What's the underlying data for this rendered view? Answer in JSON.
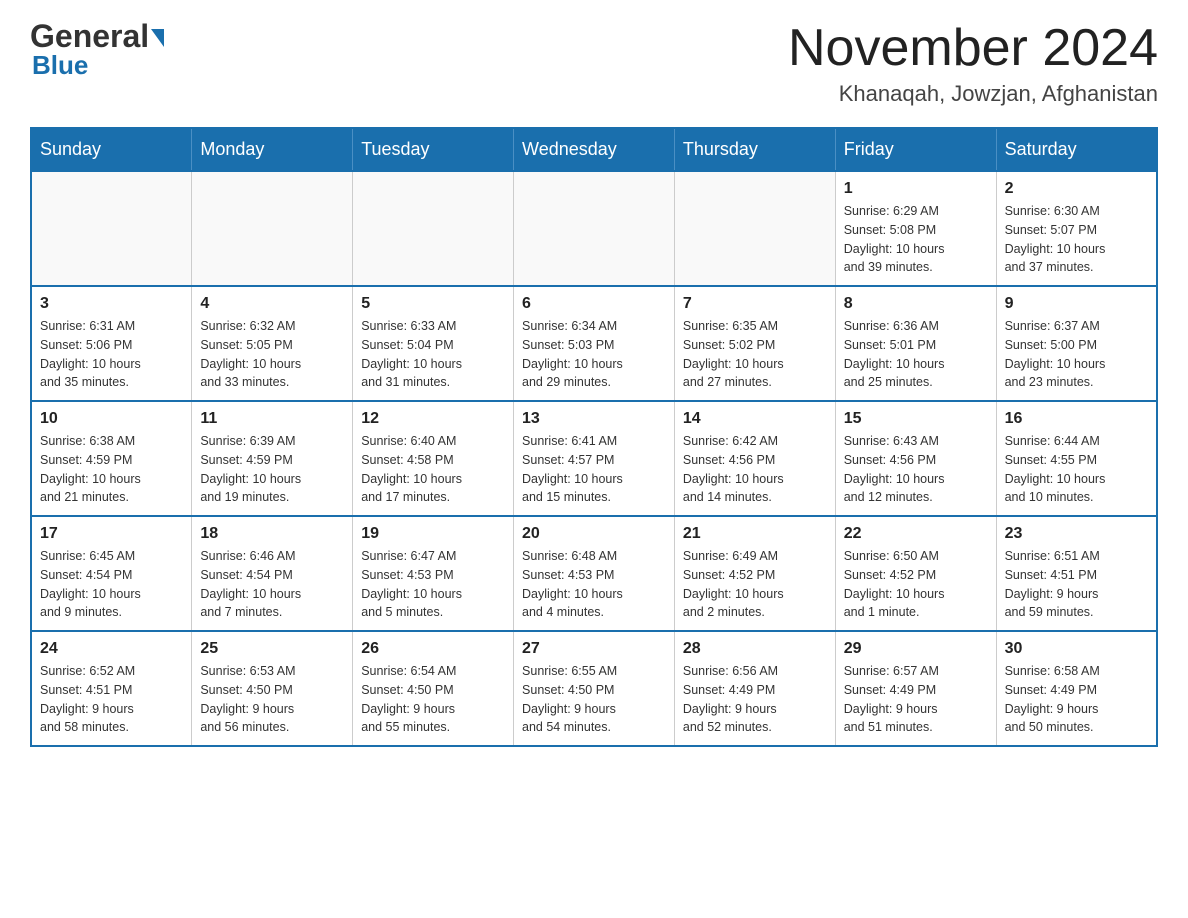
{
  "header": {
    "logo_general": "General",
    "logo_blue": "Blue",
    "month_title": "November 2024",
    "location": "Khanaqah, Jowzjan, Afghanistan"
  },
  "days_of_week": [
    "Sunday",
    "Monday",
    "Tuesday",
    "Wednesday",
    "Thursday",
    "Friday",
    "Saturday"
  ],
  "weeks": [
    [
      {
        "day": "",
        "info": ""
      },
      {
        "day": "",
        "info": ""
      },
      {
        "day": "",
        "info": ""
      },
      {
        "day": "",
        "info": ""
      },
      {
        "day": "",
        "info": ""
      },
      {
        "day": "1",
        "info": "Sunrise: 6:29 AM\nSunset: 5:08 PM\nDaylight: 10 hours\nand 39 minutes."
      },
      {
        "day": "2",
        "info": "Sunrise: 6:30 AM\nSunset: 5:07 PM\nDaylight: 10 hours\nand 37 minutes."
      }
    ],
    [
      {
        "day": "3",
        "info": "Sunrise: 6:31 AM\nSunset: 5:06 PM\nDaylight: 10 hours\nand 35 minutes."
      },
      {
        "day": "4",
        "info": "Sunrise: 6:32 AM\nSunset: 5:05 PM\nDaylight: 10 hours\nand 33 minutes."
      },
      {
        "day": "5",
        "info": "Sunrise: 6:33 AM\nSunset: 5:04 PM\nDaylight: 10 hours\nand 31 minutes."
      },
      {
        "day": "6",
        "info": "Sunrise: 6:34 AM\nSunset: 5:03 PM\nDaylight: 10 hours\nand 29 minutes."
      },
      {
        "day": "7",
        "info": "Sunrise: 6:35 AM\nSunset: 5:02 PM\nDaylight: 10 hours\nand 27 minutes."
      },
      {
        "day": "8",
        "info": "Sunrise: 6:36 AM\nSunset: 5:01 PM\nDaylight: 10 hours\nand 25 minutes."
      },
      {
        "day": "9",
        "info": "Sunrise: 6:37 AM\nSunset: 5:00 PM\nDaylight: 10 hours\nand 23 minutes."
      }
    ],
    [
      {
        "day": "10",
        "info": "Sunrise: 6:38 AM\nSunset: 4:59 PM\nDaylight: 10 hours\nand 21 minutes."
      },
      {
        "day": "11",
        "info": "Sunrise: 6:39 AM\nSunset: 4:59 PM\nDaylight: 10 hours\nand 19 minutes."
      },
      {
        "day": "12",
        "info": "Sunrise: 6:40 AM\nSunset: 4:58 PM\nDaylight: 10 hours\nand 17 minutes."
      },
      {
        "day": "13",
        "info": "Sunrise: 6:41 AM\nSunset: 4:57 PM\nDaylight: 10 hours\nand 15 minutes."
      },
      {
        "day": "14",
        "info": "Sunrise: 6:42 AM\nSunset: 4:56 PM\nDaylight: 10 hours\nand 14 minutes."
      },
      {
        "day": "15",
        "info": "Sunrise: 6:43 AM\nSunset: 4:56 PM\nDaylight: 10 hours\nand 12 minutes."
      },
      {
        "day": "16",
        "info": "Sunrise: 6:44 AM\nSunset: 4:55 PM\nDaylight: 10 hours\nand 10 minutes."
      }
    ],
    [
      {
        "day": "17",
        "info": "Sunrise: 6:45 AM\nSunset: 4:54 PM\nDaylight: 10 hours\nand 9 minutes."
      },
      {
        "day": "18",
        "info": "Sunrise: 6:46 AM\nSunset: 4:54 PM\nDaylight: 10 hours\nand 7 minutes."
      },
      {
        "day": "19",
        "info": "Sunrise: 6:47 AM\nSunset: 4:53 PM\nDaylight: 10 hours\nand 5 minutes."
      },
      {
        "day": "20",
        "info": "Sunrise: 6:48 AM\nSunset: 4:53 PM\nDaylight: 10 hours\nand 4 minutes."
      },
      {
        "day": "21",
        "info": "Sunrise: 6:49 AM\nSunset: 4:52 PM\nDaylight: 10 hours\nand 2 minutes."
      },
      {
        "day": "22",
        "info": "Sunrise: 6:50 AM\nSunset: 4:52 PM\nDaylight: 10 hours\nand 1 minute."
      },
      {
        "day": "23",
        "info": "Sunrise: 6:51 AM\nSunset: 4:51 PM\nDaylight: 9 hours\nand 59 minutes."
      }
    ],
    [
      {
        "day": "24",
        "info": "Sunrise: 6:52 AM\nSunset: 4:51 PM\nDaylight: 9 hours\nand 58 minutes."
      },
      {
        "day": "25",
        "info": "Sunrise: 6:53 AM\nSunset: 4:50 PM\nDaylight: 9 hours\nand 56 minutes."
      },
      {
        "day": "26",
        "info": "Sunrise: 6:54 AM\nSunset: 4:50 PM\nDaylight: 9 hours\nand 55 minutes."
      },
      {
        "day": "27",
        "info": "Sunrise: 6:55 AM\nSunset: 4:50 PM\nDaylight: 9 hours\nand 54 minutes."
      },
      {
        "day": "28",
        "info": "Sunrise: 6:56 AM\nSunset: 4:49 PM\nDaylight: 9 hours\nand 52 minutes."
      },
      {
        "day": "29",
        "info": "Sunrise: 6:57 AM\nSunset: 4:49 PM\nDaylight: 9 hours\nand 51 minutes."
      },
      {
        "day": "30",
        "info": "Sunrise: 6:58 AM\nSunset: 4:49 PM\nDaylight: 9 hours\nand 50 minutes."
      }
    ]
  ]
}
